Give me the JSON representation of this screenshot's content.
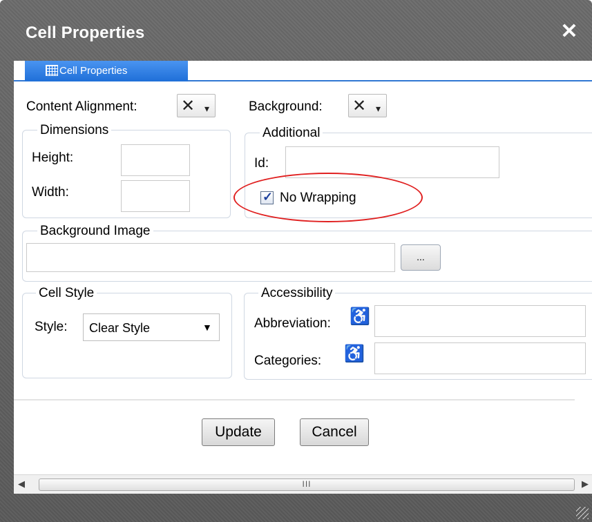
{
  "dialog": {
    "title": "Cell Properties",
    "close_label": "✕"
  },
  "tabs": [
    {
      "label": "Cell Properties",
      "icon": "table-grid-icon",
      "active": true
    }
  ],
  "content_alignment": {
    "label": "Content Alignment:",
    "value_icon": "✕",
    "caret": "▾"
  },
  "background": {
    "label": "Background:",
    "value_icon": "✕",
    "caret": "▾"
  },
  "dimensions": {
    "legend": "Dimensions",
    "height_label": "Height:",
    "height_value": "",
    "width_label": "Width:",
    "width_value": ""
  },
  "additional": {
    "legend": "Additional",
    "id_label": "Id:",
    "id_value": "",
    "no_wrapping_label": "No Wrapping",
    "no_wrapping_checked": true,
    "highlight_color": "#e02020"
  },
  "background_image": {
    "legend": "Background Image",
    "value": "",
    "browse_label": "..."
  },
  "cell_style": {
    "legend": "Cell Style",
    "style_label": "Style:",
    "style_value": "Clear Style",
    "arrow": "▼"
  },
  "accessibility": {
    "legend": "Accessibility",
    "abbreviation_label": "Abbreviation:",
    "abbreviation_value": "",
    "categories_label": "Categories:",
    "categories_value": "",
    "icon_glyph": "♿"
  },
  "actions": {
    "update_label": "Update",
    "cancel_label": "Cancel"
  },
  "scrollbar": {
    "left_arrow": "◀",
    "right_arrow": "▶",
    "grip": "III"
  },
  "colors": {
    "title_bar": "#5e5e5e",
    "tab_active": "#2f76d2",
    "highlight": "#e02020"
  }
}
